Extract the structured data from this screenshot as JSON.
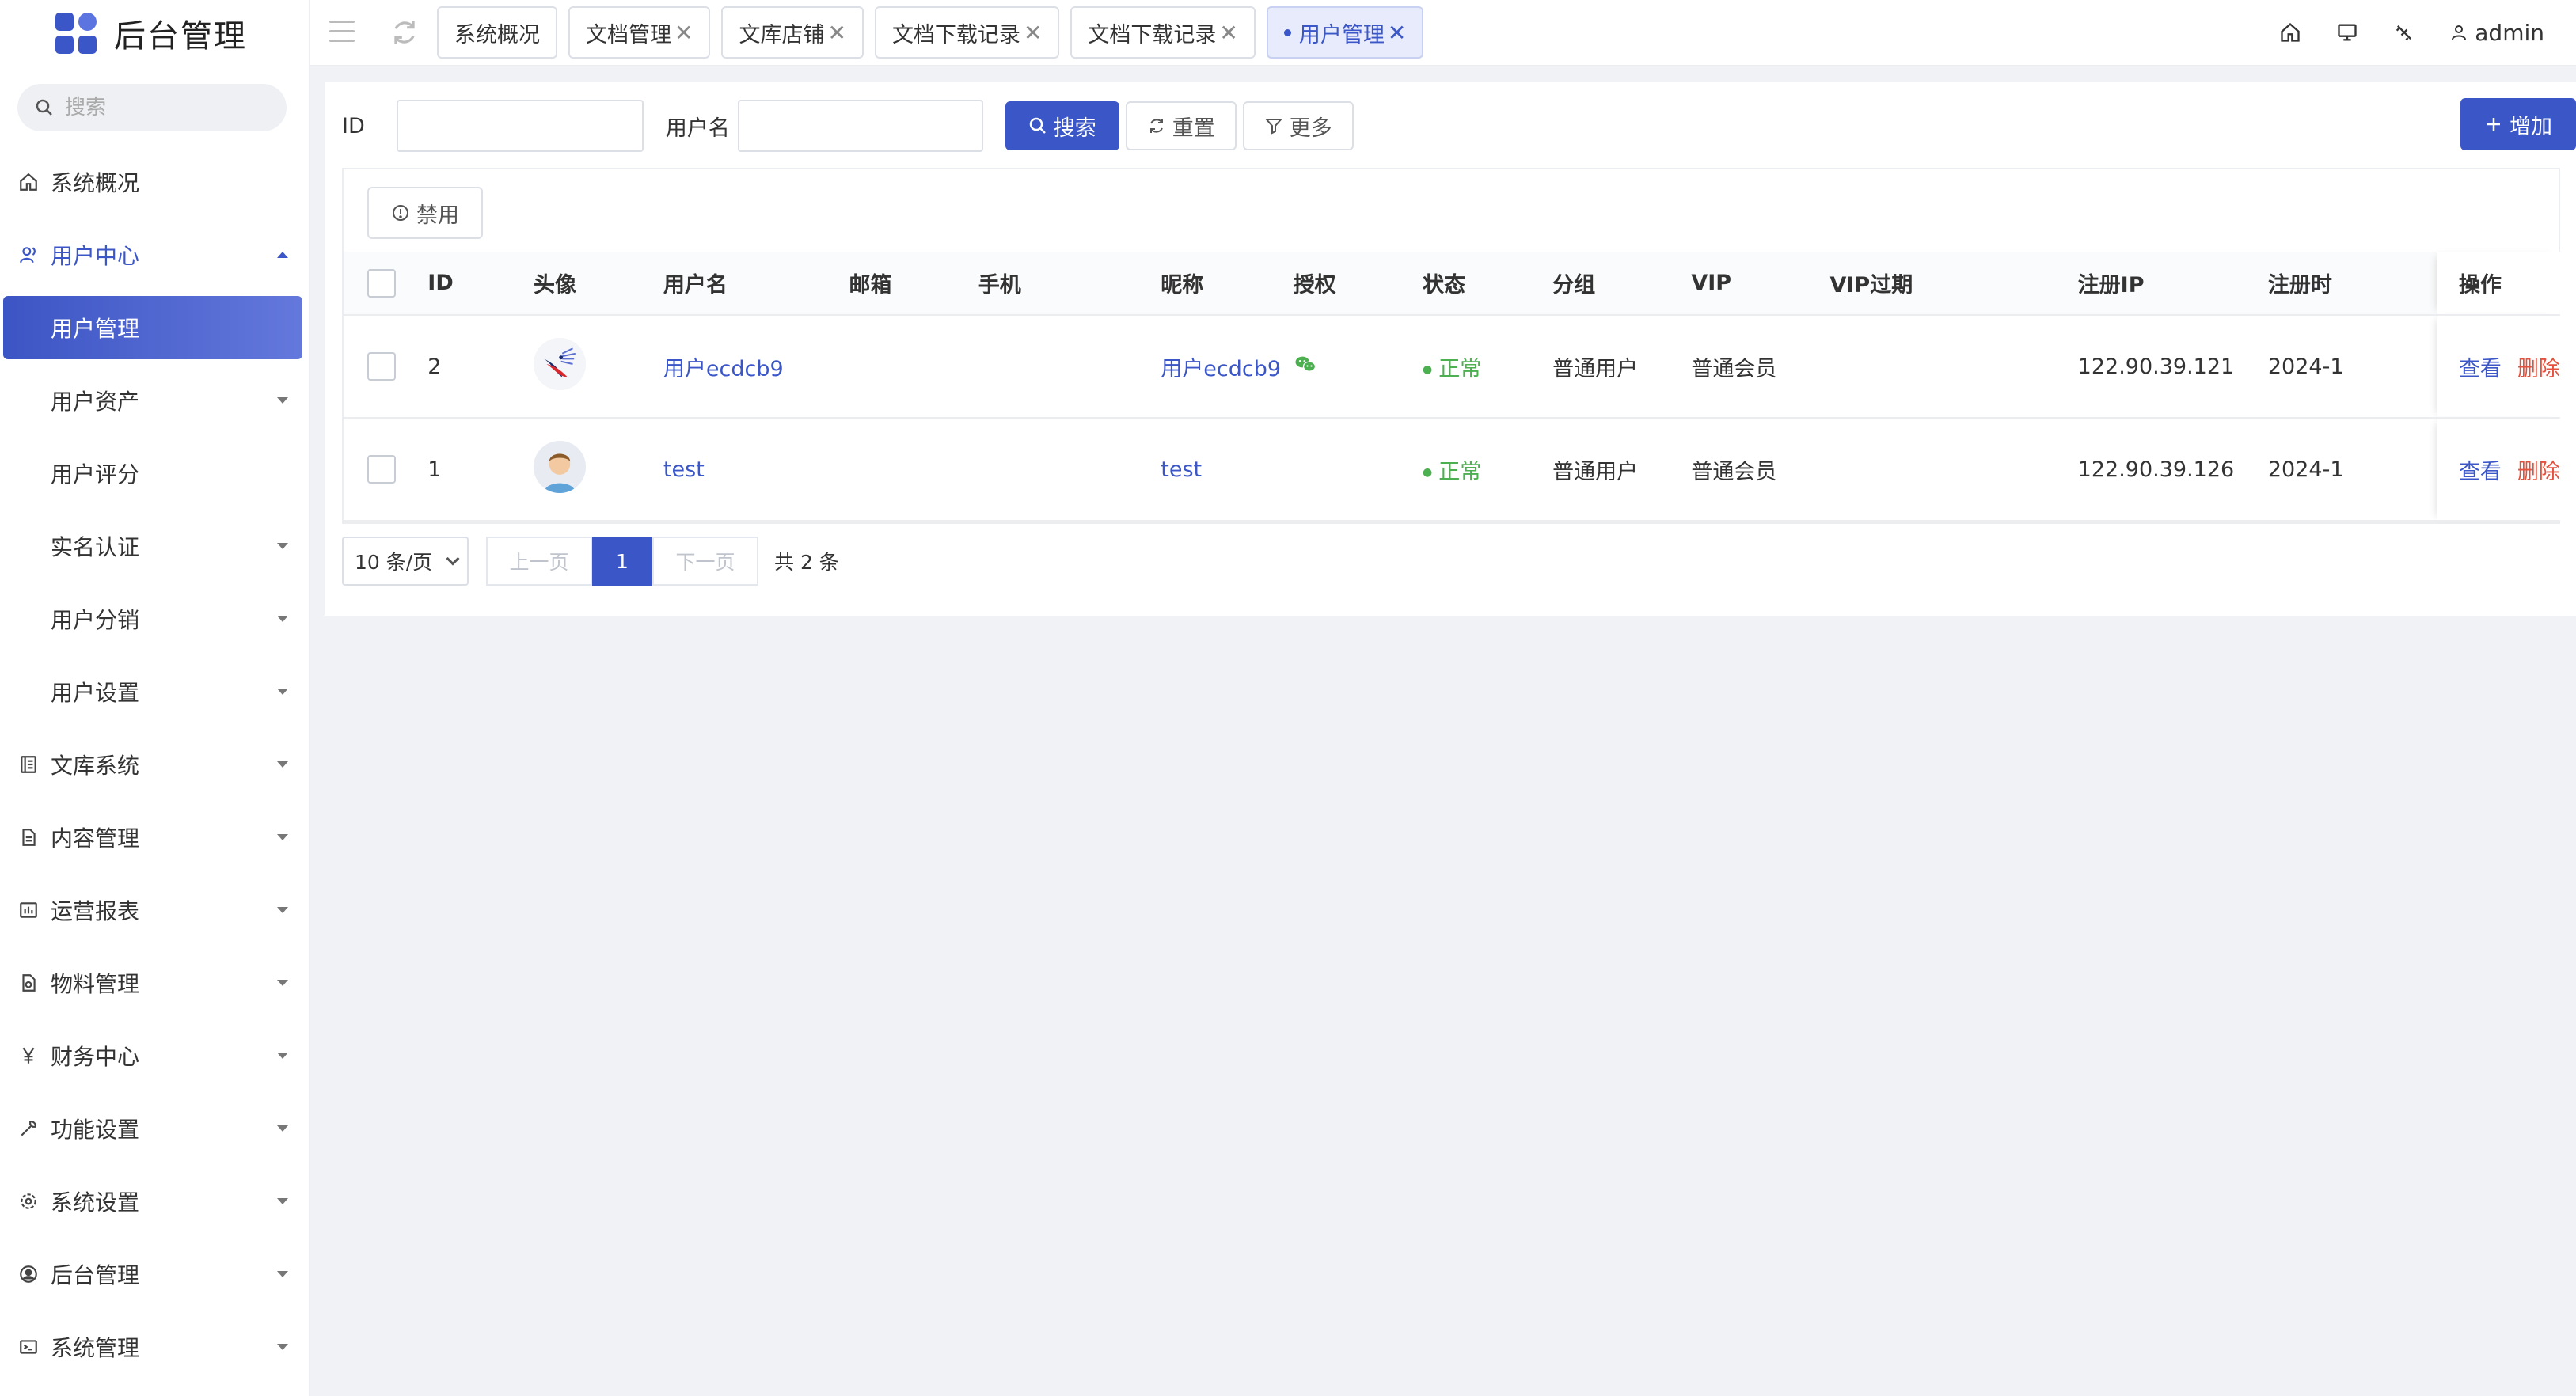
{
  "app": {
    "title": "后台管理"
  },
  "sidebar": {
    "search_placeholder": "搜索",
    "items": [
      {
        "label": "系统概况",
        "icon": "home-icon"
      },
      {
        "label": "用户中心",
        "icon": "user-icon",
        "open": true
      },
      {
        "label": "用户管理",
        "sub": true,
        "active": true
      },
      {
        "label": "用户资产",
        "sub": true
      },
      {
        "label": "用户评分",
        "sub": true
      },
      {
        "label": "实名认证",
        "sub": true
      },
      {
        "label": "用户分销",
        "sub": true
      },
      {
        "label": "用户设置",
        "sub": true
      },
      {
        "label": "文库系统",
        "icon": "library-icon"
      },
      {
        "label": "内容管理",
        "icon": "document-icon"
      },
      {
        "label": "运营报表",
        "icon": "chart-icon"
      },
      {
        "label": "物料管理",
        "icon": "file-icon"
      },
      {
        "label": "财务中心",
        "icon": "yen-icon"
      },
      {
        "label": "功能设置",
        "icon": "wrench-icon"
      },
      {
        "label": "系统设置",
        "icon": "gear-icon"
      },
      {
        "label": "后台管理",
        "icon": "user-circle-icon"
      },
      {
        "label": "系统管理",
        "icon": "terminal-icon"
      }
    ]
  },
  "topbar": {
    "tabs": [
      {
        "label": "系统概况",
        "closable": false
      },
      {
        "label": "文档管理",
        "closable": true
      },
      {
        "label": "文库店铺",
        "closable": true
      },
      {
        "label": "文档下载记录",
        "closable": true
      },
      {
        "label": "文档下载记录",
        "closable": true
      },
      {
        "label": "用户管理",
        "closable": true,
        "active": true
      }
    ],
    "close_glyph": "✕",
    "user": "admin"
  },
  "filters": {
    "id_label": "ID",
    "id_value": "",
    "username_label": "用户名",
    "username_value": "",
    "search_label": "搜索",
    "reset_label": "重置",
    "more_label": "更多",
    "add_label": "增加"
  },
  "toolbar": {
    "disable_label": "禁用"
  },
  "table": {
    "headers": {
      "id": "ID",
      "avatar": "头像",
      "username": "用户名",
      "email": "邮箱",
      "phone": "手机",
      "nickname": "昵称",
      "auth": "授权",
      "status": "状态",
      "group": "分组",
      "vip": "VIP",
      "vip_expire": "VIP过期",
      "reg_ip": "注册IP",
      "reg_time": "注册时",
      "actions": "操作"
    },
    "rows": [
      {
        "id": "2",
        "username": "用户ecdcb9",
        "email": "",
        "phone": "",
        "nickname": "用户ecdcb9",
        "auth": "wechat-icon",
        "status": "正常",
        "group": "普通用户",
        "vip": "普通会员",
        "vip_expire": "",
        "reg_ip": "122.90.39.121",
        "reg_time": "2024-1",
        "view": "查看",
        "delete": "删除"
      },
      {
        "id": "1",
        "username": "test",
        "email": "",
        "phone": "",
        "nickname": "test",
        "auth": "",
        "status": "正常",
        "group": "普通用户",
        "vip": "普通会员",
        "vip_expire": "",
        "reg_ip": "122.90.39.126",
        "reg_time": "2024-1",
        "view": "查看",
        "delete": "删除"
      }
    ]
  },
  "pager": {
    "page_size": "10 条/页",
    "prev": "上一页",
    "current": "1",
    "next": "下一页",
    "total": "共 2 条"
  },
  "colors": {
    "primary": "#3b56c7",
    "success": "#4caf50",
    "danger": "#e5513d"
  }
}
